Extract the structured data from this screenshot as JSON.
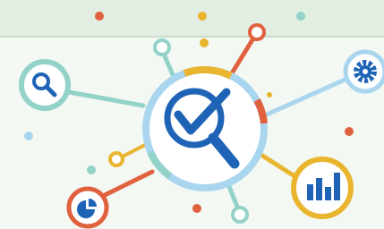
{
  "colors": {
    "background": "#f3f8f3",
    "top_band": "#e2eee2",
    "band_line": "#c9ddca",
    "teal": "#93d2c8",
    "light_blue": "#a9d6ee",
    "blue": "#1e63b6",
    "orange": "#e0613d",
    "yellow": "#e9b52f",
    "white": "#ffffff"
  },
  "icons": {
    "center": "checkmark-magnifier-icon",
    "left": "search-icon",
    "right": "gear-icon",
    "bottom_left": "pie-chart-icon",
    "bottom_right": "bar-chart-icon"
  }
}
